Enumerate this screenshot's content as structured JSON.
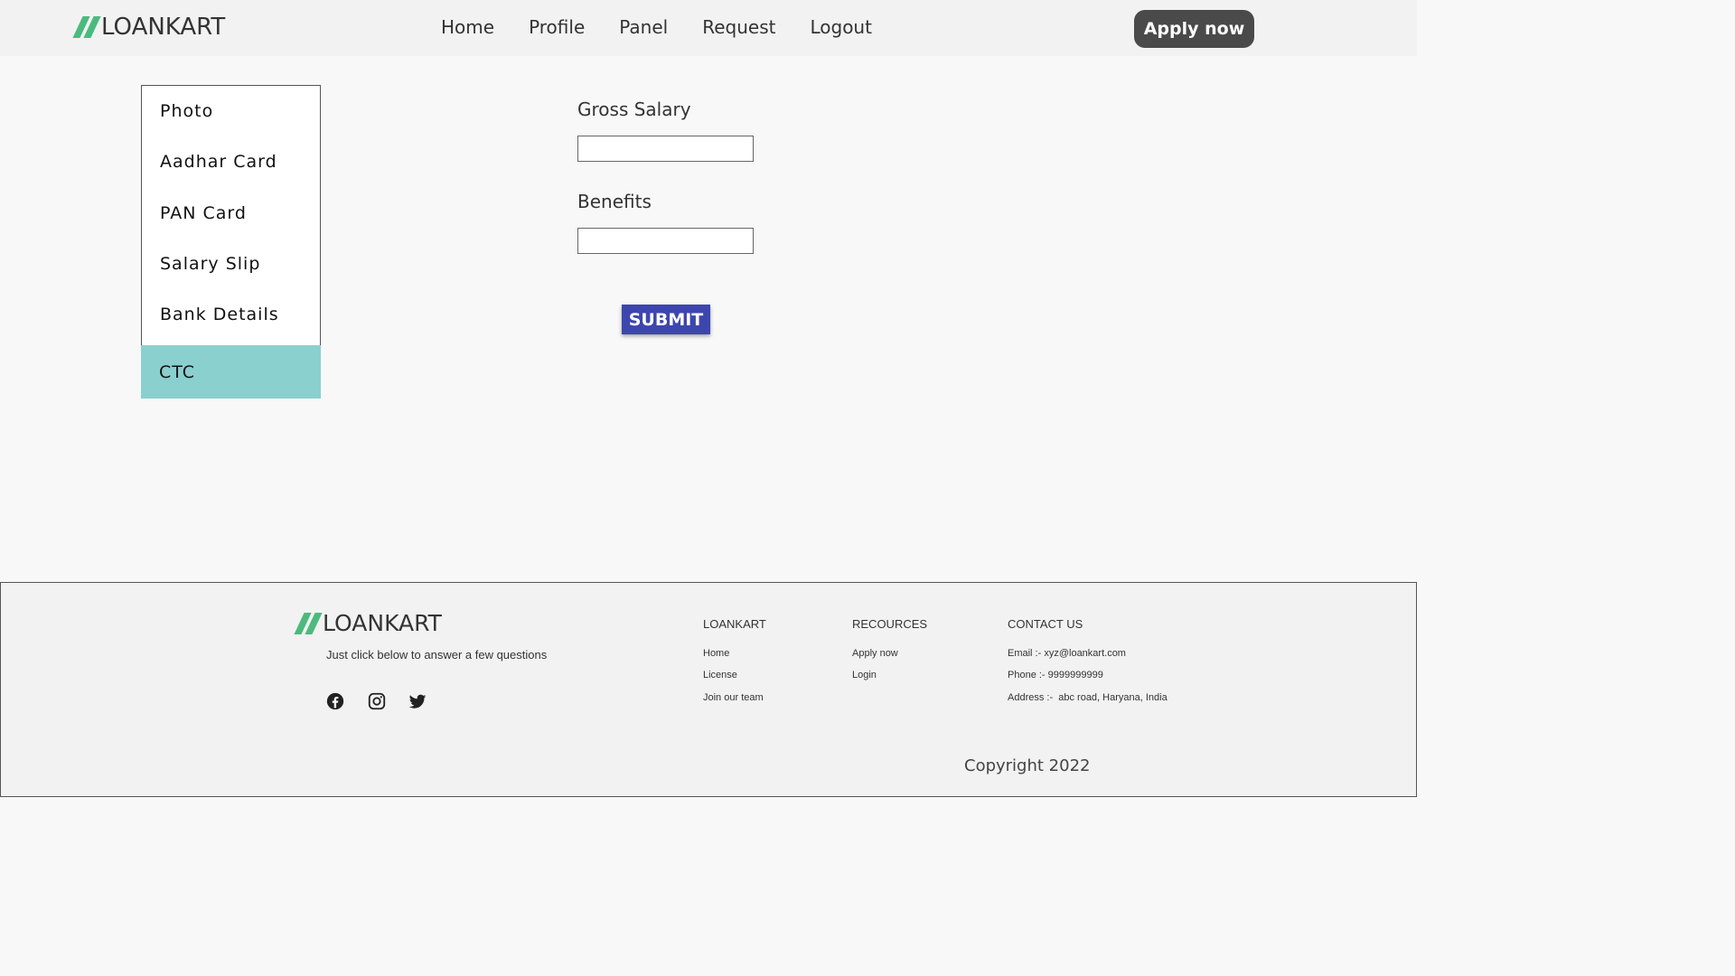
{
  "brand": {
    "name": "LOANKART",
    "accent": "#4cba7e"
  },
  "nav": {
    "items": [
      "Home",
      "Profile",
      "Panel",
      "Request",
      "Logout"
    ],
    "apply_label": "Apply now"
  },
  "sidebar": {
    "items": [
      {
        "label": "Photo",
        "active": false
      },
      {
        "label": "Aadhar Card",
        "active": false
      },
      {
        "label": "PAN Card",
        "active": false
      },
      {
        "label": "Salary Slip",
        "active": false
      },
      {
        "label": "Bank Details",
        "active": false
      },
      {
        "label": "CTC",
        "active": true
      }
    ],
    "active_color": "#8ad0ce"
  },
  "form": {
    "fields": [
      {
        "label": "Gross Salary",
        "value": ""
      },
      {
        "label": "Benefits",
        "value": ""
      }
    ],
    "submit_label": "SUBMIT",
    "submit_color": "#3d46ad"
  },
  "footer": {
    "brand": "LOANKART",
    "tagline": "Just click below to answer a few questions",
    "social": [
      "facebook-icon",
      "instagram-icon",
      "twitter-icon"
    ],
    "columns": {
      "loankart": {
        "title": "LOANKART",
        "links": [
          "Home",
          "License",
          "Join our team"
        ]
      },
      "resources": {
        "title": "RECOURCES",
        "links": [
          "Apply now",
          "Login"
        ]
      },
      "contact": {
        "title": "CONTACT US",
        "email": "Email :- xyz@loankart.com",
        "phone": "Phone :- 9999999999",
        "address": "Address :-  abc road, Haryana, India"
      }
    },
    "copyright": "Copyright 2022"
  }
}
